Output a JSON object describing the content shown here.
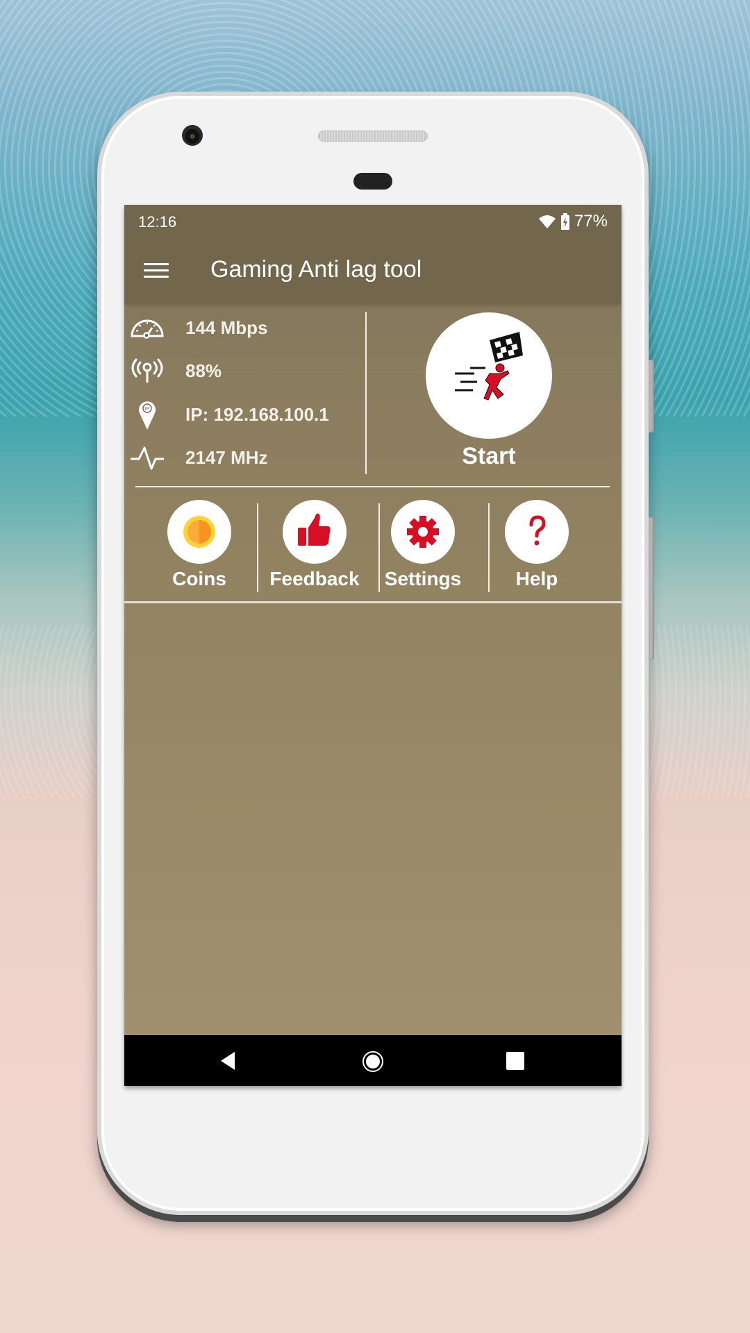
{
  "status_bar": {
    "time": "12:16",
    "battery": "77%",
    "icons": [
      "wifi-icon",
      "battery-charging-icon"
    ]
  },
  "app_bar": {
    "title": "Gaming Anti lag tool",
    "menu_icon": "hamburger-menu-icon"
  },
  "info": [
    {
      "icon": "speedometer-icon",
      "value": "144 Mbps"
    },
    {
      "icon": "signal-antenna-icon",
      "value": "88%"
    },
    {
      "icon": "ip-location-pin-icon",
      "value": "IP: 192.168.100.1"
    },
    {
      "icon": "pulse-icon",
      "value": "2147 MHz"
    }
  ],
  "start": {
    "label": "Start",
    "icon": "running-man-finish-flag-icon"
  },
  "actions": [
    {
      "label": "Coins",
      "icon": "coin-icon"
    },
    {
      "label": "Feedback",
      "icon": "thumbs-up-icon"
    },
    {
      "label": "Settings",
      "icon": "gear-icon"
    },
    {
      "label": "Help",
      "icon": "question-mark-icon"
    }
  ],
  "nav_bar": {
    "back": "back-icon",
    "home": "home-icon",
    "recents": "recents-icon"
  },
  "colors": {
    "app_bar": "#72674c",
    "content": "#918260",
    "accent_red": "#d80f24",
    "coin_orange": "#f5a623"
  }
}
